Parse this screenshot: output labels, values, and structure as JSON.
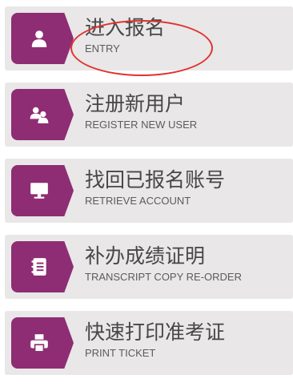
{
  "items": [
    {
      "title": "进入报名",
      "subtitle": "ENTRY",
      "icon": "user-icon"
    },
    {
      "title": "注册新用户",
      "subtitle": "REGISTER NEW USER",
      "icon": "users-icon"
    },
    {
      "title": "找回已报名账号",
      "subtitle": "RETRIEVE ACCOUNT",
      "icon": "monitor-icon"
    },
    {
      "title": "补办成绩证明",
      "subtitle": "TRANSCRIPT COPY RE-ORDER",
      "icon": "notebook-icon"
    },
    {
      "title": "快速打印准考证",
      "subtitle": "PRINT TICKET",
      "icon": "printer-icon"
    }
  ],
  "colors": {
    "tile": "#8e2d73",
    "card": "#e9e7e8",
    "text": "#474747",
    "annotation": "#e0322d"
  }
}
